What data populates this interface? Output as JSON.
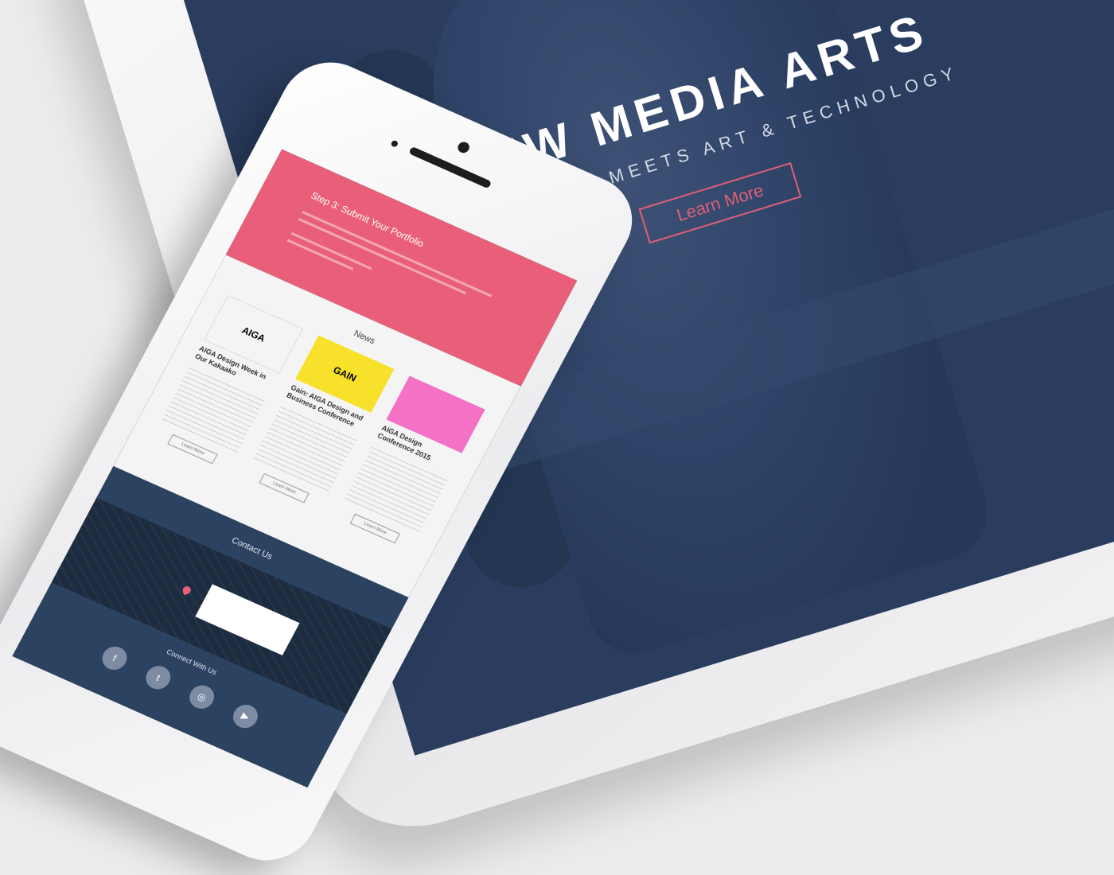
{
  "tablet": {
    "hero_title": "NEW MEDIA ARTS",
    "hero_subtitle": "CREATIVITY MEETS ART & TECHNOLOGY",
    "cta_label": "Learn More"
  },
  "phone": {
    "step_title": "Step 3: Submit Your Portfolio",
    "news_title": "News",
    "cards": [
      {
        "thumb_label": "AIGA",
        "title": "AIGA Design Week in Our Kakaako",
        "button": "Learn More",
        "color": "#f4f4f4"
      },
      {
        "thumb_label": "GAIN",
        "title": "Gain: AIGA Design and Business Conference",
        "button": "Learn More",
        "color": "#f7e12a"
      },
      {
        "thumb_label": "",
        "title": "AIGA Design Conference 2015",
        "button": "Learn More",
        "color": "#f472c6"
      }
    ],
    "contact_title": "Contact Us",
    "connect_title": "Connect With Us",
    "social_icons": [
      "facebook-icon",
      "twitter-icon",
      "instagram-icon",
      "youtube-icon"
    ]
  },
  "colors": {
    "navy": "#2a3d5f",
    "pink": "#e95f79",
    "accent_outline": "#e05e78"
  }
}
